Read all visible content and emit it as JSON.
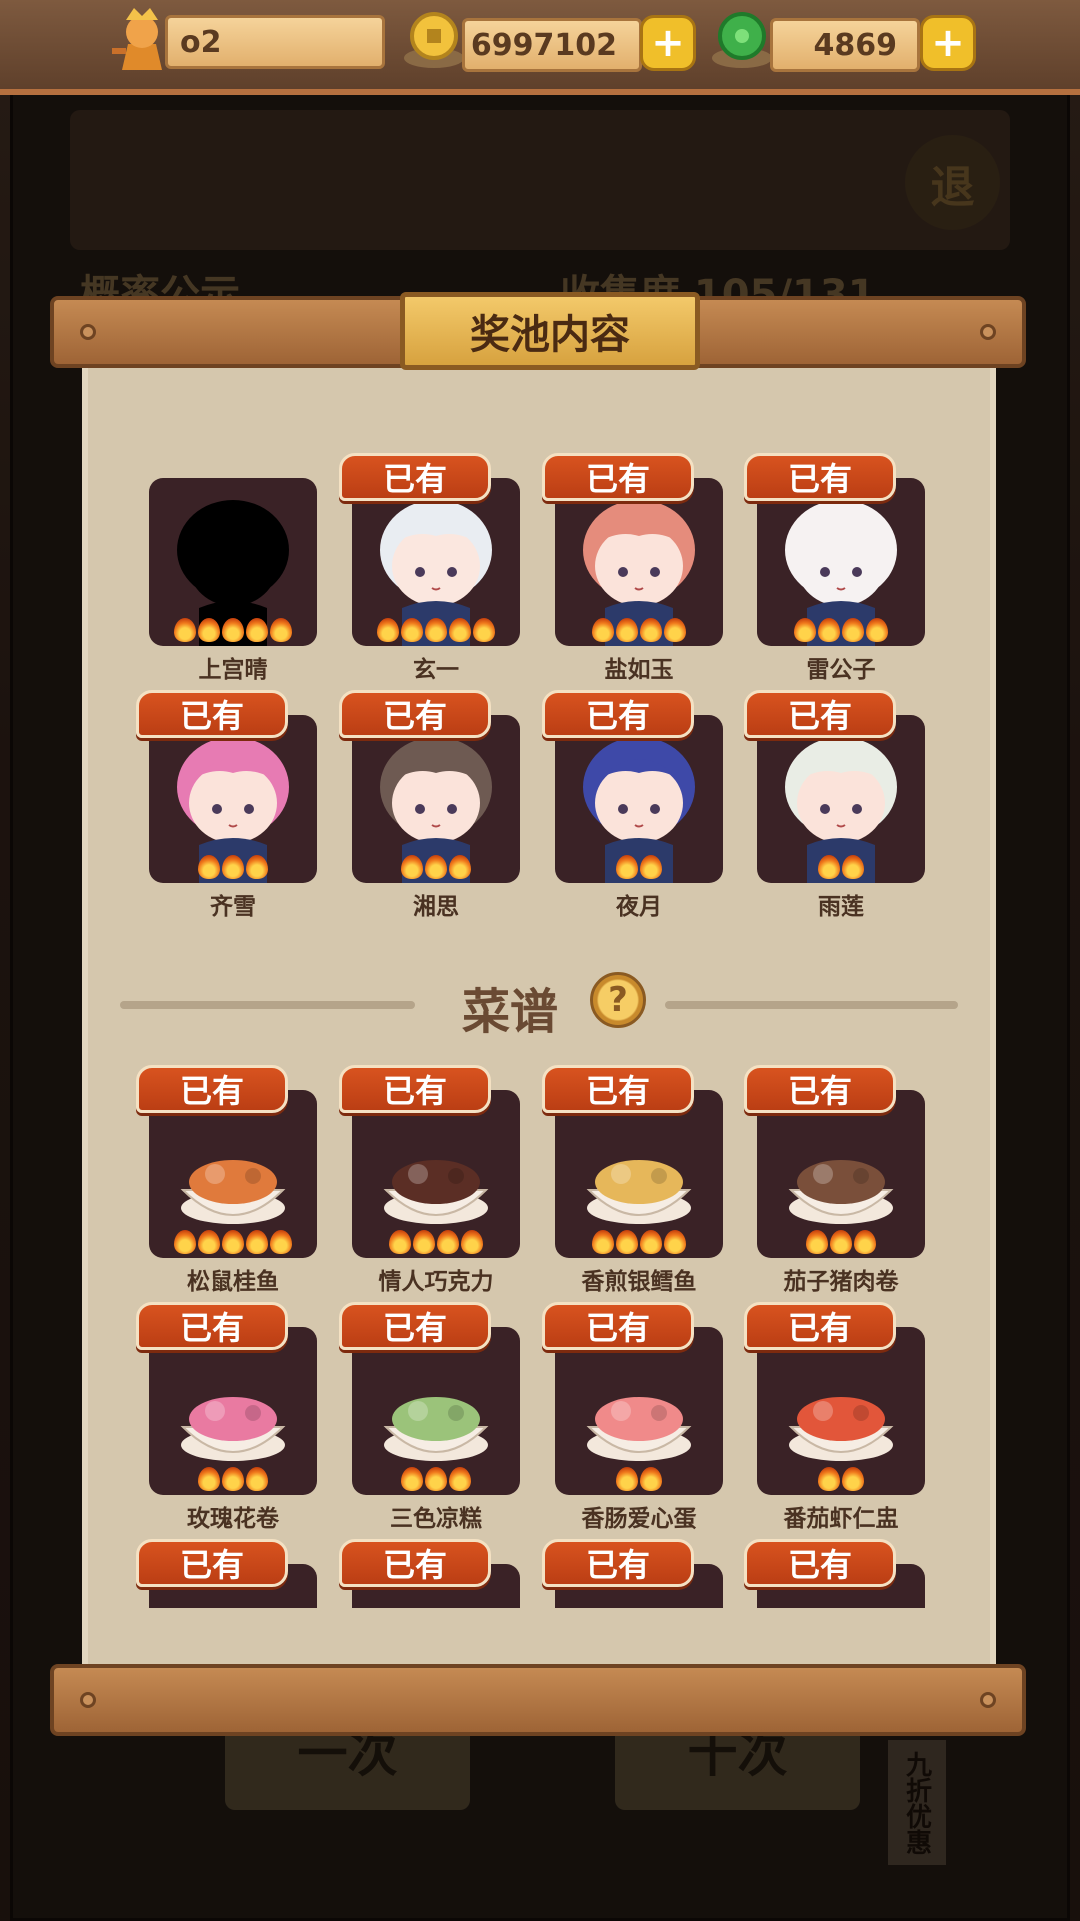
{
  "topbar": {
    "player_name": "o2",
    "coins": "6997102",
    "gems": "4869"
  },
  "background": {
    "exit_label": "退",
    "announce_label": "概率公示",
    "collection_label": "收集度 105/131",
    "draw_once_label": "一次",
    "draw_ten_label": "十次",
    "discount_label": "九折优惠"
  },
  "panel": {
    "title": "奖池内容",
    "owned_label": "已有",
    "recipes_title": "菜谱",
    "characters": [
      {
        "name": "上宫晴",
        "stars": 5,
        "owned": false,
        "skin": "#000000",
        "hair": "#000000"
      },
      {
        "name": "玄一",
        "stars": 5,
        "owned": true,
        "skin": "#fbe7df",
        "hair": "#e9edf2"
      },
      {
        "name": "盐如玉",
        "stars": 4,
        "owned": true,
        "skin": "#fbe3da",
        "hair": "#e58c7c"
      },
      {
        "name": "雷公子",
        "stars": 4,
        "owned": true,
        "skin": "#f6f2f2",
        "hair": "#f6f2f2"
      },
      {
        "name": "齐雪",
        "stars": 3,
        "owned": true,
        "skin": "#fbe3da",
        "hair": "#e77bb3"
      },
      {
        "name": "湘思",
        "stars": 3,
        "owned": true,
        "skin": "#fbe3da",
        "hair": "#6e5a52"
      },
      {
        "name": "夜月",
        "stars": 2,
        "owned": true,
        "skin": "#fbe3da",
        "hair": "#3e49a8"
      },
      {
        "name": "雨莲",
        "stars": 2,
        "owned": true,
        "skin": "#fbe3da",
        "hair": "#e9ede5"
      }
    ],
    "recipes": [
      {
        "name": "松鼠桂鱼",
        "stars": 5,
        "owned": true,
        "food": "#e07a3c"
      },
      {
        "name": "情人巧克力",
        "stars": 4,
        "owned": true,
        "food": "#5b2e25"
      },
      {
        "name": "香煎银鳕鱼",
        "stars": 4,
        "owned": true,
        "food": "#e6b75a"
      },
      {
        "name": "茄子猪肉卷",
        "stars": 3,
        "owned": true,
        "food": "#7a4f3a"
      },
      {
        "name": "玫瑰花卷",
        "stars": 3,
        "owned": true,
        "food": "#e97aa1"
      },
      {
        "name": "三色凉糕",
        "stars": 3,
        "owned": true,
        "food": "#9bc37a"
      },
      {
        "name": "香肠爱心蛋",
        "stars": 2,
        "owned": true,
        "food": "#f08a8a"
      },
      {
        "name": "番茄虾仁盅",
        "stars": 2,
        "owned": true,
        "food": "#e2563a"
      }
    ],
    "partial_row_count": 4
  }
}
